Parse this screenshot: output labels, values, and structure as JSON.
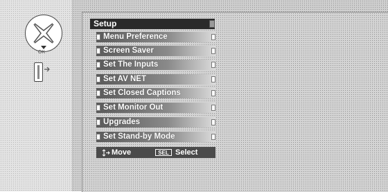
{
  "remote": {
    "dpad_icon": "dpad-icon",
    "ok_label": "OK",
    "button_icon": "tv-button-icon"
  },
  "menu": {
    "title": "Setup",
    "items": [
      {
        "label": "Menu Preference"
      },
      {
        "label": "Screen Saver"
      },
      {
        "label": "Set The Inputs"
      },
      {
        "label": "Set AV NET"
      },
      {
        "label": "Set Closed Captions"
      },
      {
        "label": "Set Monitor Out"
      },
      {
        "label": "Upgrades"
      },
      {
        "label": "Set Stand-by Mode"
      }
    ],
    "footer": {
      "move_label": "Move",
      "sel_badge": "SEL",
      "select_label": "Select"
    }
  },
  "colors": {
    "title_bg": "#2a2a2a",
    "item_gradient_dark": "#5a5a5a",
    "item_gradient_light": "#dcdcdc",
    "text": "#ffffff"
  }
}
